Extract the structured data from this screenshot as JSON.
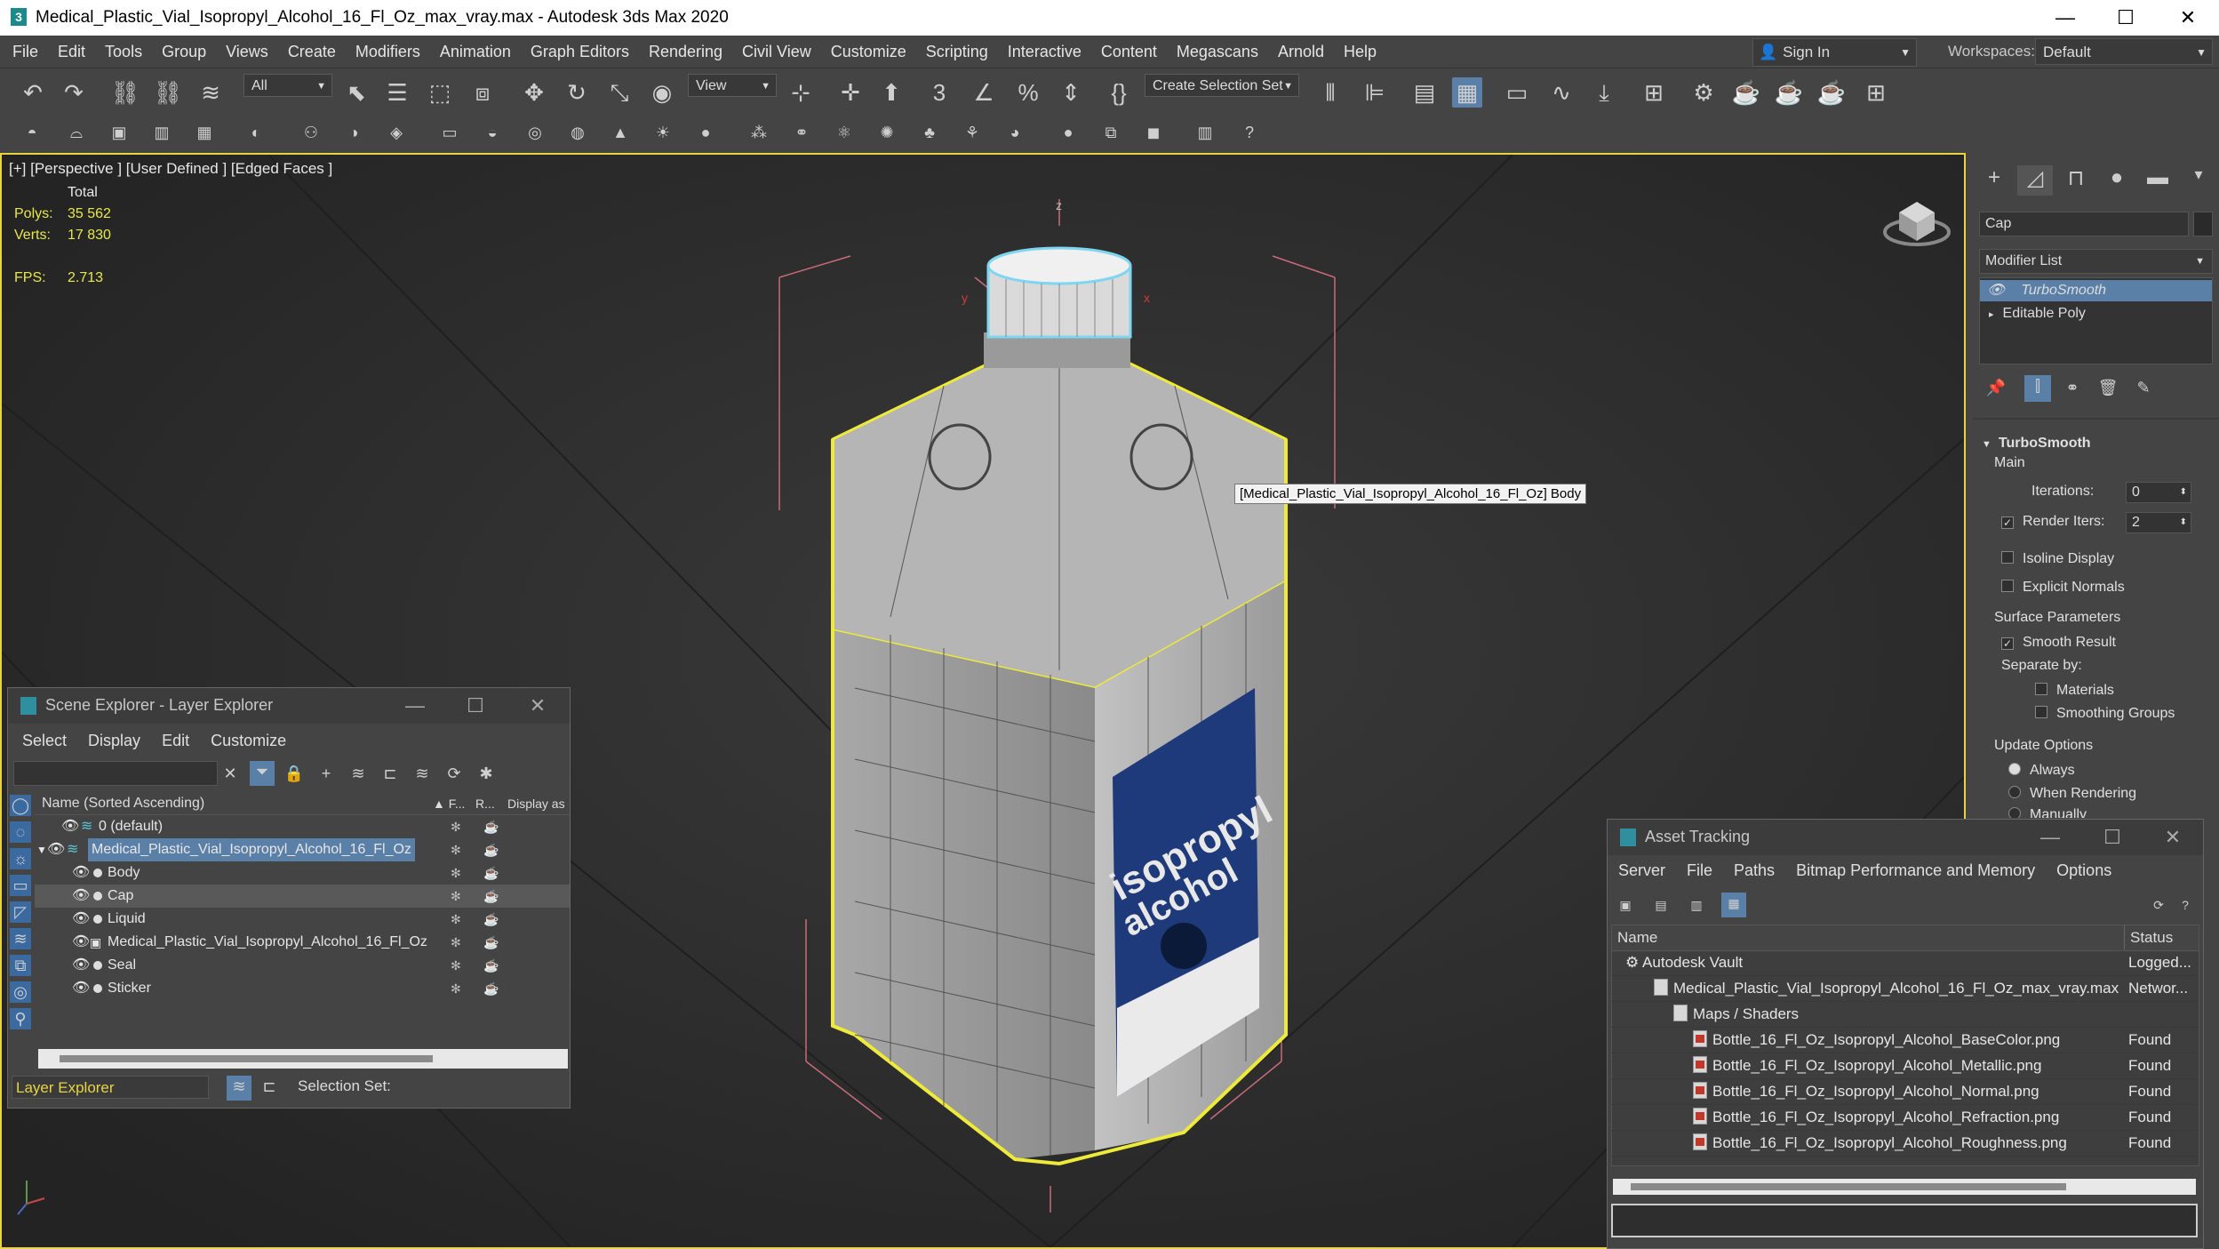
{
  "app": {
    "title": "Medical_Plastic_Vial_Isopropyl_Alcohol_16_Fl_Oz_max_vray.max - Autodesk 3ds Max 2020",
    "menus": [
      "File",
      "Edit",
      "Tools",
      "Group",
      "Views",
      "Create",
      "Modifiers",
      "Animation",
      "Graph Editors",
      "Rendering",
      "Civil View",
      "Customize",
      "Scripting",
      "Interactive",
      "Content",
      "Megascans",
      "Arnold",
      "Help"
    ],
    "sign_in": "Sign In",
    "workspaces_label": "Workspaces:",
    "workspace": "Default"
  },
  "toolbar": {
    "filter": "All",
    "reference": "View",
    "selection_set": "Create Selection Set"
  },
  "viewport": {
    "label": "[+] [Perspective ] [User Defined ] [Edged Faces ]",
    "stats_header": "Total",
    "polys_label": "Polys:",
    "polys": "35 562",
    "verts_label": "Verts:",
    "verts": "17 830",
    "fps_label": "FPS:",
    "fps": "2.713",
    "tooltip": "[Medical_Plastic_Vial_Isopropyl_Alcohol_16_Fl_Oz] Body",
    "label_text1": "isopropyl",
    "label_text2": "alcohol"
  },
  "command_panel": {
    "object_name": "Cap",
    "modifier_list": "Modifier List",
    "stack": [
      "TurboSmooth",
      "Editable Poly"
    ],
    "rollout_title": "TurboSmooth",
    "main": "Main",
    "iterations_label": "Iterations:",
    "iterations": "0",
    "render_iters_label": "Render Iters:",
    "render_iters": "2",
    "isoline": "Isoline Display",
    "explicit_normals": "Explicit Normals",
    "surface_params": "Surface Parameters",
    "smooth_result": "Smooth Result",
    "separate_by": "Separate by:",
    "materials": "Materials",
    "smoothing_groups": "Smoothing Groups",
    "update_options": "Update Options",
    "always": "Always",
    "when_rendering": "When Rendering",
    "manually": "Manually"
  },
  "scene_explorer": {
    "title": "Scene Explorer - Layer Explorer",
    "menus": [
      "Select",
      "Display",
      "Edit",
      "Customize"
    ],
    "col_name": "Name (Sorted Ascending)",
    "col_f": "▲ F...",
    "col_r": "R...",
    "col_display": "Display as",
    "rows": [
      {
        "name": "0 (default)",
        "indent": 1
      },
      {
        "name": "Medical_Plastic_Vial_Isopropyl_Alcohol_16_Fl_Oz",
        "indent": 0
      },
      {
        "name": "Body",
        "indent": 2
      },
      {
        "name": "Cap",
        "indent": 2
      },
      {
        "name": "Liquid",
        "indent": 2
      },
      {
        "name": "Medical_Plastic_Vial_Isopropyl_Alcohol_16_Fl_Oz",
        "indent": 2
      },
      {
        "name": "Seal",
        "indent": 2
      },
      {
        "name": "Sticker",
        "indent": 2
      }
    ],
    "footer_explorer": "Layer Explorer",
    "selection_set_label": "Selection Set:"
  },
  "asset_tracking": {
    "title": "Asset Tracking",
    "menus": [
      "Server",
      "File",
      "Paths",
      "Bitmap Performance and Memory",
      "Options"
    ],
    "col_name": "Name",
    "col_status": "Status",
    "rows": [
      {
        "name": "Autodesk Vault",
        "status": "Logged...",
        "indent": 0,
        "icon": "vault"
      },
      {
        "name": "Medical_Plastic_Vial_Isopropyl_Alcohol_16_Fl_Oz_max_vray.max",
        "status": "Networ...",
        "indent": 1,
        "icon": "max"
      },
      {
        "name": "Maps / Shaders",
        "status": "",
        "indent": 2,
        "icon": "folder"
      },
      {
        "name": "Bottle_16_Fl_Oz_Isopropyl_Alcohol_BaseColor.png",
        "status": "Found",
        "indent": 3,
        "icon": "png"
      },
      {
        "name": "Bottle_16_Fl_Oz_Isopropyl_Alcohol_Metallic.png",
        "status": "Found",
        "indent": 3,
        "icon": "png"
      },
      {
        "name": "Bottle_16_Fl_Oz_Isopropyl_Alcohol_Normal.png",
        "status": "Found",
        "indent": 3,
        "icon": "png"
      },
      {
        "name": "Bottle_16_Fl_Oz_Isopropyl_Alcohol_Refraction.png",
        "status": "Found",
        "indent": 3,
        "icon": "png"
      },
      {
        "name": "Bottle_16_Fl_Oz_Isopropyl_Alcohol_Roughness.png",
        "status": "Found",
        "indent": 3,
        "icon": "png"
      }
    ]
  }
}
